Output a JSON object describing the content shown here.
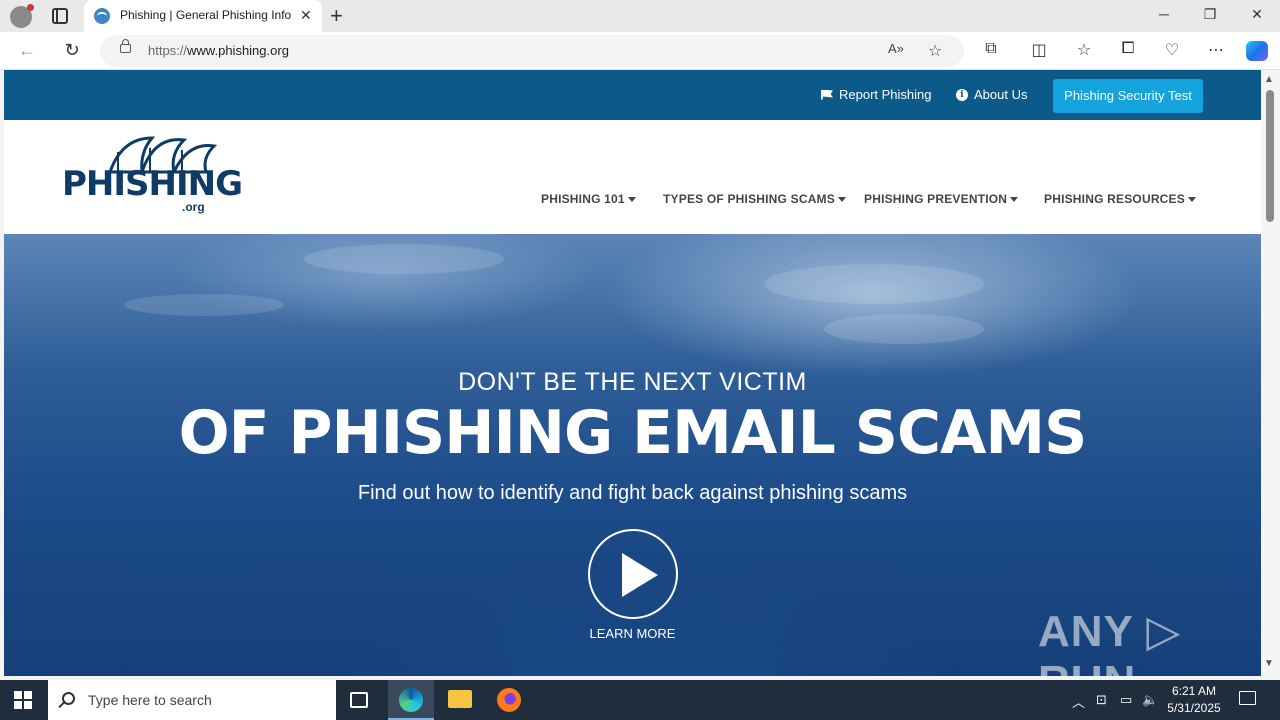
{
  "browser": {
    "tab_title": "Phishing | General Phishing Information",
    "url_scheme": "https://",
    "url_host": "www.phishing.org",
    "window_controls": {
      "minimize": "─",
      "restore": "❐",
      "close": "✕"
    }
  },
  "topbar": {
    "report_label": "Report Phishing",
    "about_label": "About Us",
    "cta_label": "Phishing Security Test"
  },
  "logo": {
    "text": "PHISHING",
    "sub": ".org"
  },
  "nav": {
    "items": [
      {
        "label": "PHISHING 101"
      },
      {
        "label": "TYPES OF PHISHING SCAMS"
      },
      {
        "label": "PHISHING PREVENTION"
      },
      {
        "label": "PHISHING RESOURCES"
      }
    ]
  },
  "hero": {
    "pre": "DON'T BE THE NEXT VICTIM",
    "title": "OF PHISHING EMAIL SCAMS",
    "sub": "Find out how to identify and fight back against phishing scams",
    "learn_more": "LEARN MORE",
    "watermark": "ANY ▷ RUN"
  },
  "taskbar": {
    "search_placeholder": "Type here to search",
    "time": "6:21 AM",
    "date": "5/31/2025"
  },
  "colors": {
    "topbar": "#0b5a8a",
    "cta": "#14a3dd",
    "logo": "#0f3b66",
    "taskbar": "#1f2d3d"
  }
}
